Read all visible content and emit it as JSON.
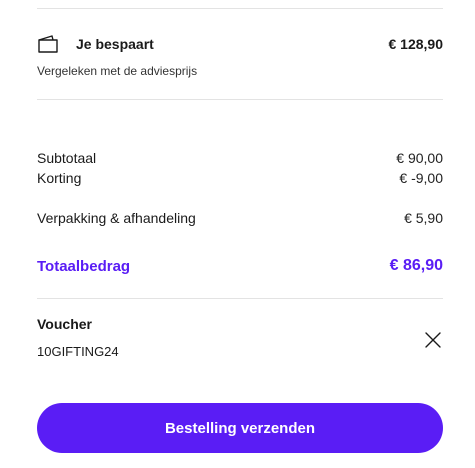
{
  "savings": {
    "title": "Je bespaart",
    "amount": "€ 128,90",
    "subtitle": "Vergeleken met de adviesprijs",
    "icon": "wallet-icon"
  },
  "summary": {
    "subtotal": {
      "label": "Subtotaal",
      "value": "€ 90,00"
    },
    "discount": {
      "label": "Korting",
      "value": "€ -9,00"
    },
    "packaging": {
      "label": "Verpakking & afhandeling",
      "value": "€ 5,90"
    },
    "total": {
      "label": "Totaalbedrag",
      "value": "€ 86,90"
    }
  },
  "voucher": {
    "title": "Voucher",
    "code": "10GIFTING24",
    "remove_icon": "close-icon"
  },
  "actions": {
    "submit_label": "Bestelling verzenden"
  },
  "colors": {
    "accent": "#5a1df5",
    "divider": "#e3e3e3",
    "text": "#1a1a1a"
  }
}
